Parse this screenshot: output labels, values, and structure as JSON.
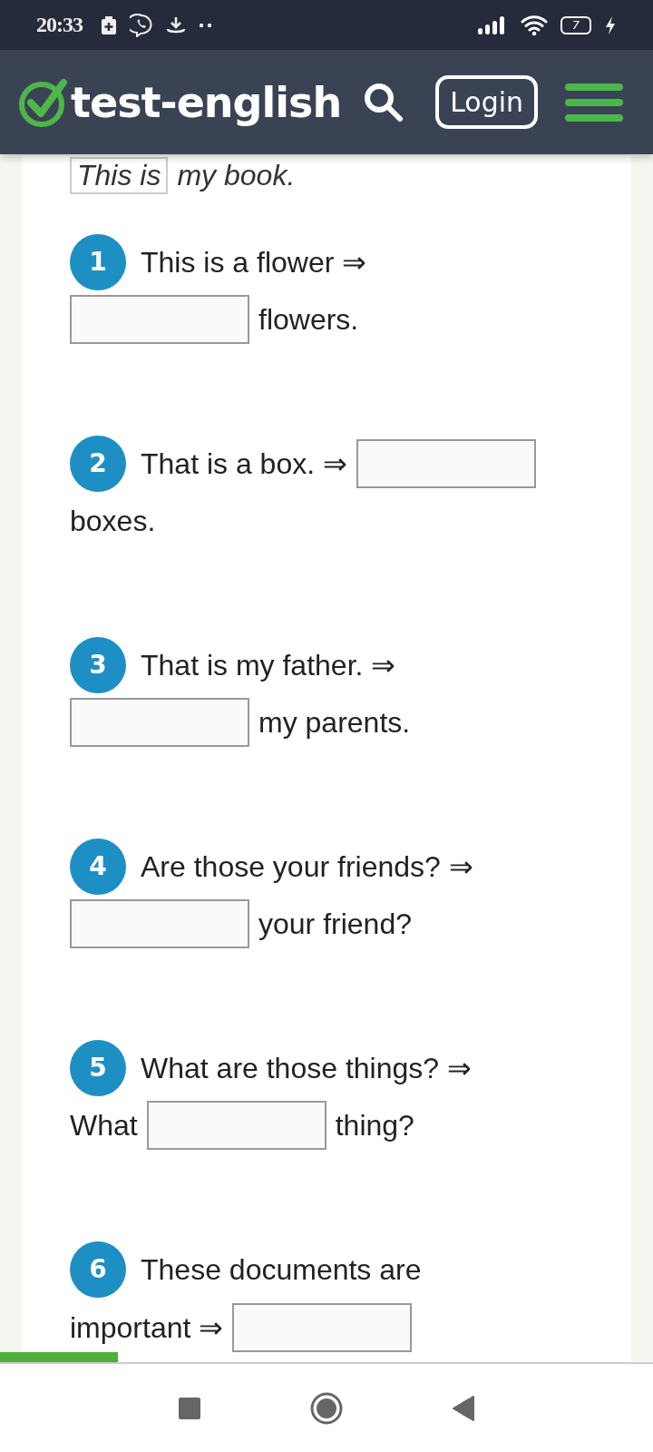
{
  "status_bar": {
    "time": "20:33",
    "battery": "7"
  },
  "header": {
    "logo": "test-english",
    "login": "Login"
  },
  "example": {
    "answer": "This is",
    "rest": "my book."
  },
  "items": [
    {
      "number": "1",
      "parts": [
        {
          "kind": "text",
          "text": "This is a flower ⇒"
        },
        {
          "kind": "break"
        },
        {
          "kind": "blank"
        },
        {
          "kind": "text",
          "text": "flowers."
        }
      ]
    },
    {
      "number": "2",
      "parts": [
        {
          "kind": "text",
          "text": "That is a box. ⇒"
        },
        {
          "kind": "blank"
        },
        {
          "kind": "break"
        },
        {
          "kind": "text",
          "text": "boxes."
        }
      ]
    },
    {
      "number": "3",
      "parts": [
        {
          "kind": "text",
          "text": "That is my father. ⇒"
        },
        {
          "kind": "break"
        },
        {
          "kind": "blank"
        },
        {
          "kind": "text",
          "text": "my parents."
        }
      ]
    },
    {
      "number": "4",
      "parts": [
        {
          "kind": "text",
          "text": "Are those your friends? ⇒"
        },
        {
          "kind": "break"
        },
        {
          "kind": "blank"
        },
        {
          "kind": "text",
          "text": "your friend?"
        }
      ]
    },
    {
      "number": "5",
      "parts": [
        {
          "kind": "text",
          "text": "What are those things? ⇒"
        },
        {
          "kind": "break"
        },
        {
          "kind": "text",
          "text": "What"
        },
        {
          "kind": "blank"
        },
        {
          "kind": "text",
          "text": "thing?"
        }
      ]
    },
    {
      "number": "6",
      "parts": [
        {
          "kind": "text",
          "text": "These documents are"
        },
        {
          "kind": "break"
        },
        {
          "kind": "text",
          "text": "important ⇒"
        },
        {
          "kind": "blank"
        }
      ]
    }
  ],
  "progress": {
    "level": 0.18
  }
}
